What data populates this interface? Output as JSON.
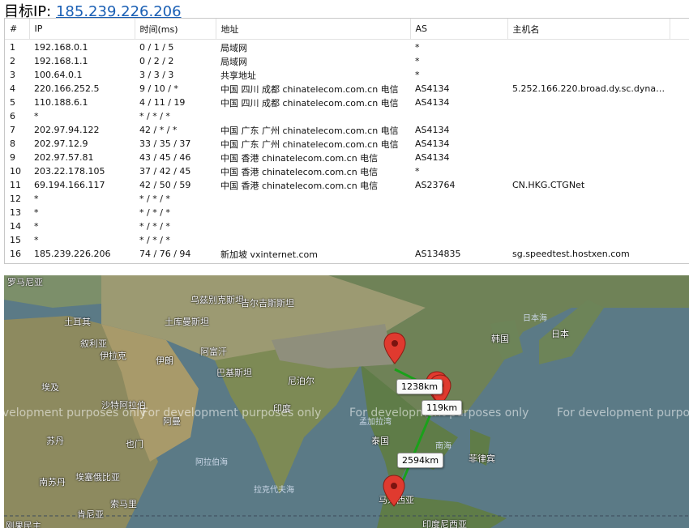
{
  "header": {
    "label": "目标IP:",
    "ip": "185.239.226.206"
  },
  "table": {
    "columns": [
      "#",
      "IP",
      "时间(ms)",
      "地址",
      "AS",
      "主机名"
    ],
    "rows": [
      [
        "1",
        "192.168.0.1",
        "0 / 1 / 5",
        "局域网",
        "*",
        ""
      ],
      [
        "2",
        "192.168.1.1",
        "0 / 2 / 2",
        "局域网",
        "*",
        ""
      ],
      [
        "3",
        "100.64.0.1",
        "3 / 3 / 3",
        "共享地址",
        "*",
        ""
      ],
      [
        "4",
        "220.166.252.5",
        "9 / 10 / *",
        "中国 四川 成都 chinatelecom.com.cn 电信",
        "AS4134",
        "5.252.166.220.broad.dy.sc.dynami..."
      ],
      [
        "5",
        "110.188.6.1",
        "4 / 11 / 19",
        "中国 四川 成都 chinatelecom.com.cn 电信",
        "AS4134",
        ""
      ],
      [
        "6",
        "*",
        "* / * / *",
        "",
        "",
        ""
      ],
      [
        "7",
        "202.97.94.122",
        "42 / * / *",
        "中国 广东 广州 chinatelecom.com.cn 电信",
        "AS4134",
        ""
      ],
      [
        "8",
        "202.97.12.9",
        "33 / 35 / 37",
        "中国 广东 广州 chinatelecom.com.cn 电信",
        "AS4134",
        ""
      ],
      [
        "9",
        "202.97.57.81",
        "43 / 45 / 46",
        "中国 香港 chinatelecom.com.cn 电信",
        "AS4134",
        ""
      ],
      [
        "10",
        "203.22.178.105",
        "37 / 42 / 45",
        "中国 香港 chinatelecom.com.cn 电信",
        "*",
        ""
      ],
      [
        "11",
        "69.194.166.117",
        "42 / 50 / 59",
        "中国 香港 chinatelecom.com.cn 电信",
        "AS23764",
        "CN.HKG.CTGNet"
      ],
      [
        "12",
        "*",
        "* / * / *",
        "",
        "",
        ""
      ],
      [
        "13",
        "*",
        "* / * / *",
        "",
        "",
        ""
      ],
      [
        "14",
        "*",
        "* / * / *",
        "",
        "",
        ""
      ],
      [
        "15",
        "*",
        "* / * / *",
        "",
        "",
        ""
      ],
      [
        "16",
        "185.239.226.206",
        "74 / 76 / 94",
        "新加坡 vxinternet.com",
        "AS134835",
        "sg.speedtest.hostxen.com"
      ]
    ]
  },
  "map": {
    "labels": [
      "罗马尼亚",
      "乌兹别克斯坦",
      "吉尔吉斯斯坦",
      "日本海",
      "土耳其",
      "土库曼斯坦",
      "韩国",
      "日本",
      "叙利亚",
      "伊拉克",
      "伊朗",
      "阿富汗",
      "巴基斯坦",
      "埃及",
      "沙特阿拉伯",
      "尼泊尔",
      "印度",
      "阿曼",
      "泰国",
      "苏丹",
      "也门",
      "南海",
      "菲律宾",
      "南苏丹",
      "埃塞俄比亚",
      "阿拉伯海",
      "孟加拉湾",
      "索马里",
      "肯尼亚",
      "拉克代夫海",
      "印度尼西亚",
      "刚果民主",
      "马来西亚"
    ],
    "watermark": "For development purposes only",
    "distances": [
      "1238km",
      "119km",
      "2594km"
    ]
  },
  "colors": {
    "route": "#1aa11a",
    "pin": "#e03a2f",
    "link": "#1a5fb4"
  }
}
